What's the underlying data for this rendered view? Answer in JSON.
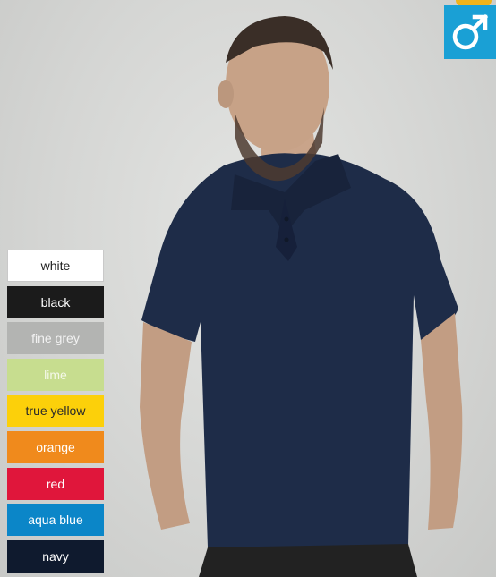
{
  "gender_icon": "male-symbol-icon",
  "badge_color": "#1aa0d5",
  "colors": [
    {
      "label": "white",
      "bg": "#ffffff",
      "fg": "#222222"
    },
    {
      "label": "black",
      "bg": "#1b1b1b",
      "fg": "#ffffff"
    },
    {
      "label": "fine grey",
      "bg": "#b3b4b2",
      "fg": "#f2f2f2"
    },
    {
      "label": "lime",
      "bg": "#c7dd8f",
      "fg": "#f4f8e8"
    },
    {
      "label": "true yellow",
      "bg": "#fcd00a",
      "fg": "#2a2a2a"
    },
    {
      "label": "orange",
      "bg": "#f08a1c",
      "fg": "#ffffff"
    },
    {
      "label": "red",
      "bg": "#e0163b",
      "fg": "#ffffff"
    },
    {
      "label": "aqua blue",
      "bg": "#0b86c8",
      "fg": "#ffffff"
    },
    {
      "label": "navy",
      "bg": "#0f1a2e",
      "fg": "#ffffff"
    }
  ]
}
